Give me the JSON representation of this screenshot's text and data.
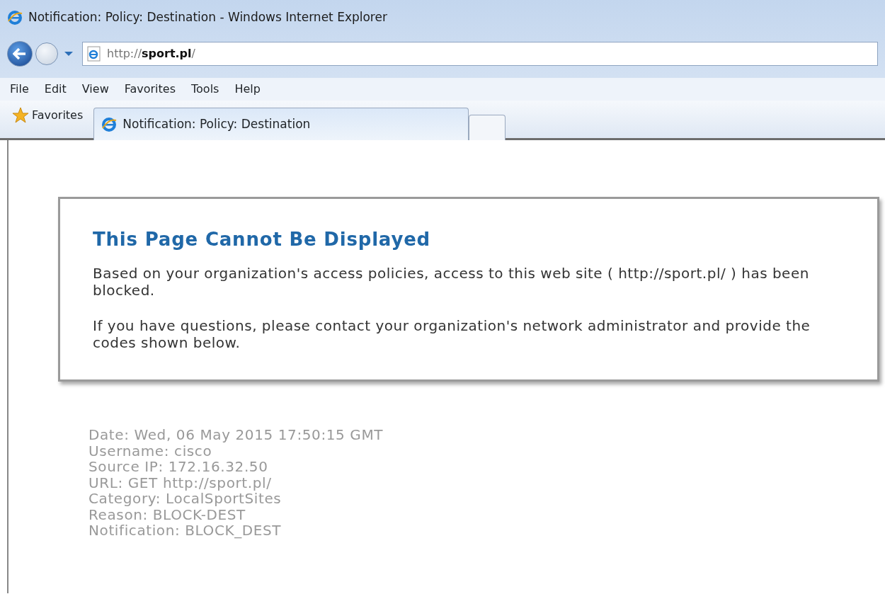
{
  "window": {
    "title": "Notification: Policy: Destination - Windows Internet Explorer"
  },
  "address_bar": {
    "url": "http://**sport.pl**/"
  },
  "menu": [
    "File",
    "Edit",
    "View",
    "Favorites",
    "Tools",
    "Help"
  ],
  "favorites_bar": {
    "label": "Favorites"
  },
  "tabs": [
    {
      "label": "Notification: Policy: Destination",
      "selected": true
    }
  ],
  "page": {
    "heading": "This Page Cannot Be Displayed",
    "paragraphs": [
      "Based on your organization's access policies, access to this web site ( http://sport.pl/ ) has been blocked.",
      "If you have questions, please contact your organization's network administrator and provide the codes shown below."
    ],
    "details": [
      "Date: Wed, 06 May 2015 17:50:15 GMT",
      "Username: cisco",
      "Source IP: 172.16.32.50",
      "URL: GET http://sport.pl/",
      "Category: LocalSportSites",
      "Reason: BLOCK-DEST",
      "Notification: BLOCK_DEST"
    ]
  }
}
